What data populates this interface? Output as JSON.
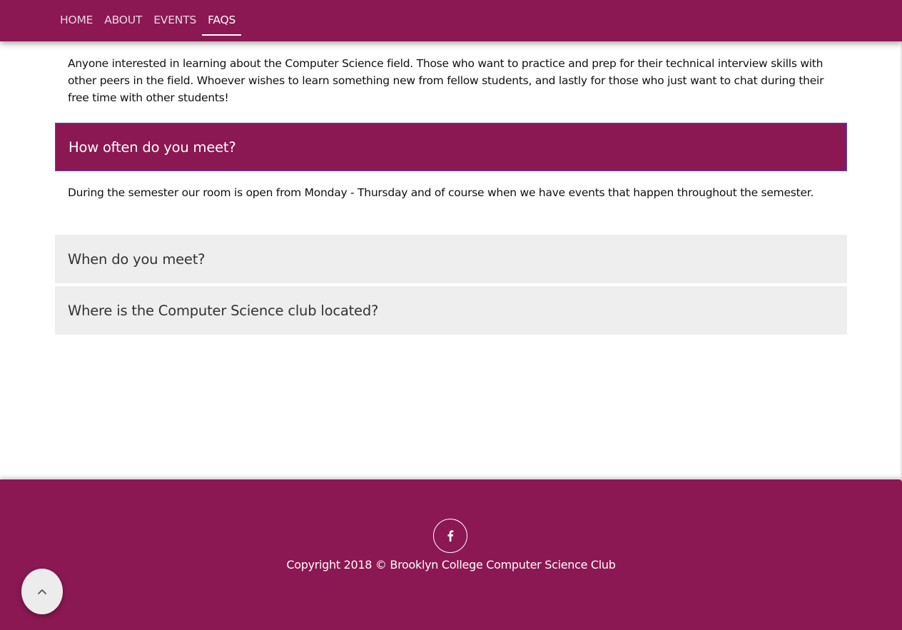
{
  "nav": {
    "items": [
      {
        "label": "HOME"
      },
      {
        "label": "ABOUT"
      },
      {
        "label": "EVENTS"
      },
      {
        "label": "FAQS"
      }
    ],
    "active": "FAQS"
  },
  "faq": {
    "answer_1": "Anyone interested in learning about the Computer Science field. Those who want to practice and prep for their technical interview skills with other peers in the field. Whoever wishes to learn something new from fellow students, and lastly for those who just want to chat during their free time with other students!",
    "question_2": "How often do you meet?",
    "answer_2": "During the semester our room is open from Monday - Thursday and of course when we have events that happen throughout the semester.",
    "question_3": "When do you meet?",
    "question_4": "Where is the Computer Science club located?"
  },
  "footer": {
    "social_icon": "facebook-icon",
    "copyright": "Copyright 2018 © Brooklyn College Computer Science Club"
  },
  "back_to_top_icon": "chevron-up-icon",
  "colors": {
    "brand": "#8b1852",
    "collapsed_bg": "#eeeeee",
    "active_border": "#5a4bc2"
  }
}
